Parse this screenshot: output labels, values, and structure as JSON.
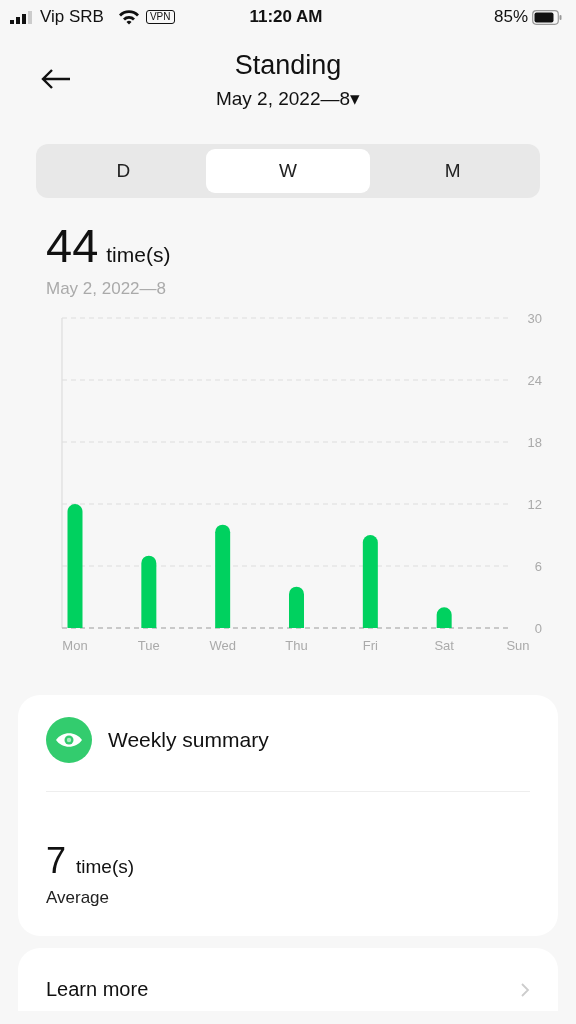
{
  "status_bar": {
    "carrier": "Vip SRB",
    "vpn": "VPN",
    "time": "11:20 AM",
    "battery": "85%"
  },
  "header": {
    "title": "Standing",
    "period": "May 2, 2022—8",
    "dropdown": "▾"
  },
  "tabs": [
    {
      "label": "D",
      "selected": false
    },
    {
      "label": "W",
      "selected": true
    },
    {
      "label": "M",
      "selected": false
    }
  ],
  "total": {
    "value": "44",
    "unit": "time(s)",
    "range": "May 2, 2022—8"
  },
  "chart_data": {
    "type": "bar",
    "categories": [
      "Mon",
      "Tue",
      "Wed",
      "Thu",
      "Fri",
      "Sat",
      "Sun"
    ],
    "grid": true,
    "series": [
      {
        "color": "#00d15f",
        "values": [
          12,
          7,
          10,
          4,
          9,
          2,
          0
        ]
      }
    ],
    "ylim": [
      0,
      30
    ],
    "yticks": [
      0,
      6,
      12,
      18,
      24,
      30
    ]
  },
  "summary": {
    "title": "Weekly summary",
    "value": "7",
    "unit": "time(s)",
    "label": "Average"
  },
  "learn_more": {
    "label": "Learn more"
  }
}
